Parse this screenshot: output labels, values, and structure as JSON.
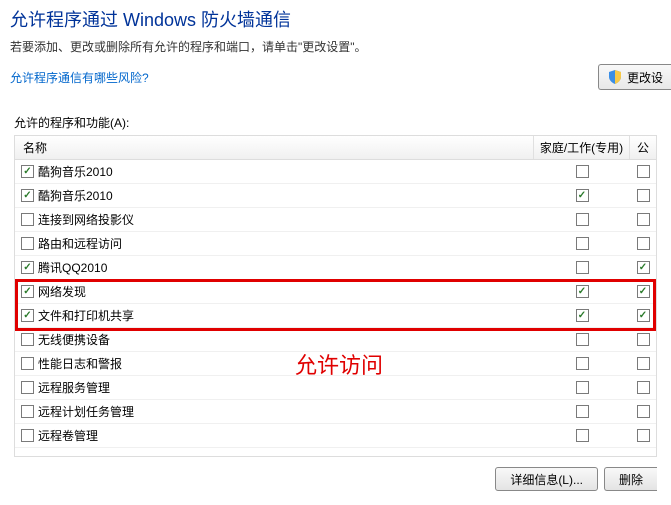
{
  "header": {
    "title": "允许程序通过 Windows 防火墙通信",
    "desc": "若要添加、更改或删除所有允许的程序和端口，请单击\"更改设置\"。",
    "risk_link": "允许程序通信有哪些风险?",
    "change_settings": "更改设"
  },
  "section_label": "允许的程序和功能(A):",
  "columns": {
    "name": "名称",
    "home": "家庭/工作(专用)",
    "public": "公"
  },
  "rows": [
    {
      "name": "酷狗音乐2010",
      "name_checked": true,
      "home_checked": false,
      "pub_checked": false
    },
    {
      "name": "酷狗音乐2010",
      "name_checked": true,
      "home_checked": true,
      "pub_checked": false
    },
    {
      "name": "连接到网络投影仪",
      "name_checked": false,
      "home_checked": false,
      "pub_checked": false
    },
    {
      "name": "路由和远程访问",
      "name_checked": false,
      "home_checked": false,
      "pub_checked": false
    },
    {
      "name": "腾讯QQ2010",
      "name_checked": true,
      "home_checked": false,
      "pub_checked": true
    },
    {
      "name": "网络发现",
      "name_checked": true,
      "home_checked": true,
      "pub_checked": true
    },
    {
      "name": "文件和打印机共享",
      "name_checked": true,
      "home_checked": true,
      "pub_checked": true
    },
    {
      "name": "无线便携设备",
      "name_checked": false,
      "home_checked": false,
      "pub_checked": false
    },
    {
      "name": "性能日志和警报",
      "name_checked": false,
      "home_checked": false,
      "pub_checked": false
    },
    {
      "name": "远程服务管理",
      "name_checked": false,
      "home_checked": false,
      "pub_checked": false
    },
    {
      "name": "远程计划任务管理",
      "name_checked": false,
      "home_checked": false,
      "pub_checked": false
    },
    {
      "name": "远程卷管理",
      "name_checked": false,
      "home_checked": false,
      "pub_checked": false
    }
  ],
  "annotation": "允许访问",
  "footer": {
    "details": "详细信息(L)...",
    "delete": "删除"
  }
}
